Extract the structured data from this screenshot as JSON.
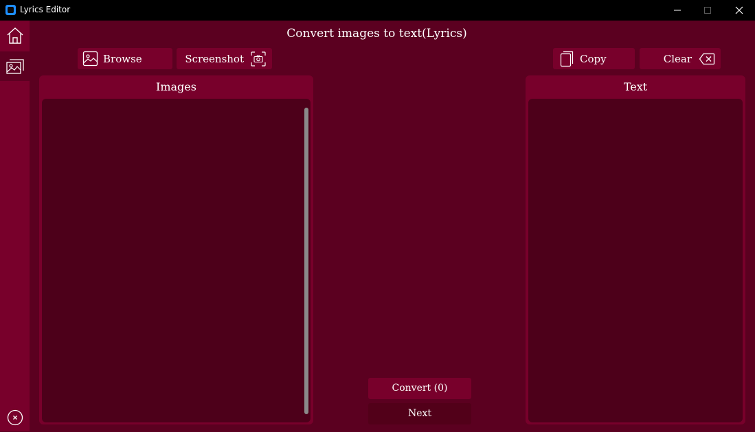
{
  "window": {
    "title": "Lyrics Editor"
  },
  "sidebar": {
    "items": [
      {
        "name": "home",
        "icon": "home-icon"
      },
      {
        "name": "images",
        "icon": "image-icon"
      },
      {
        "name": "exit",
        "icon": "close-circle-icon"
      }
    ]
  },
  "main": {
    "title": "Convert images to text(Lyrics)",
    "toolbar": {
      "browse_label": "Browse",
      "screenshot_label": "Screenshot",
      "copy_label": "Copy",
      "clear_label": "Clear"
    },
    "images_panel": {
      "title": "Images"
    },
    "text_panel": {
      "title": "Text"
    },
    "convert_label": "Convert (0)",
    "next_label": "Next"
  },
  "colors": {
    "background": "#5b0020",
    "accent": "#78002b",
    "panel_body": "#4d001a",
    "titlebar": "#000000",
    "app_icon": "#1e8fff"
  }
}
